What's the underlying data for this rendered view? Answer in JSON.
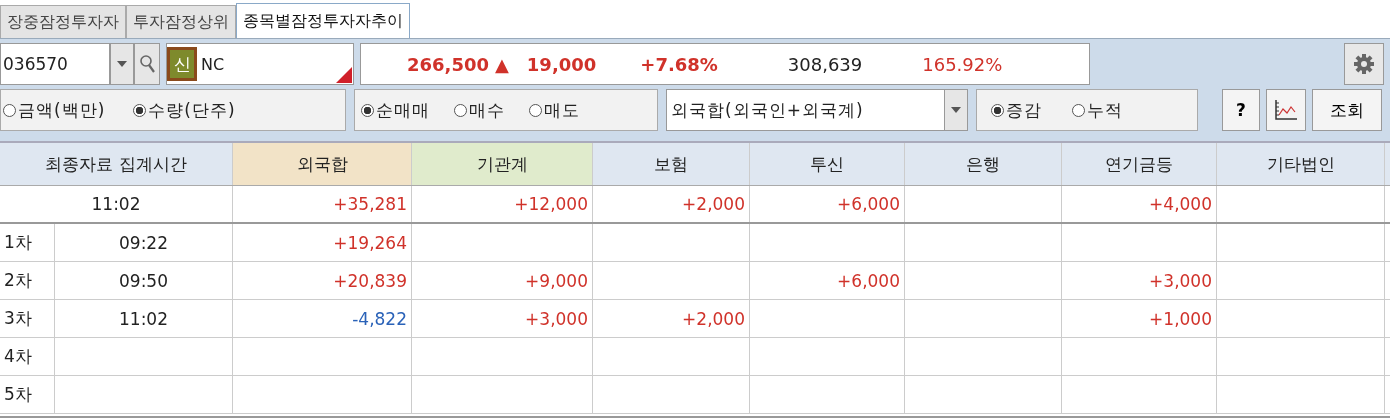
{
  "tabs": [
    {
      "label": "장중잠정투자자",
      "selected": false
    },
    {
      "label": "투자잠정상위",
      "selected": false
    },
    {
      "label": "종목별잠정투자자추이",
      "selected": true
    }
  ],
  "stock": {
    "code": "036570",
    "badge": "신",
    "name": "NC"
  },
  "quote": {
    "price": "266,500",
    "arrow": "▲",
    "change": "19,000",
    "rate": "+7.68%",
    "volume": "308,639",
    "volume_ratio": "165.92%"
  },
  "unit_options": [
    {
      "label": "금액(백만)",
      "selected": false
    },
    {
      "label": "수량(단주)",
      "selected": true
    }
  ],
  "trade_options": [
    {
      "label": "순매매",
      "selected": true
    },
    {
      "label": "매수",
      "selected": false
    },
    {
      "label": "매도",
      "selected": false
    }
  ],
  "investor_select": {
    "value": "외국합(외국인+외국계)"
  },
  "mode_options": [
    {
      "label": "증감",
      "selected": true
    },
    {
      "label": "누적",
      "selected": false
    }
  ],
  "help_button": "?",
  "query_button": "조회",
  "table": {
    "first_header": "최종자료 집계시간",
    "columns": [
      {
        "label": "외국합",
        "color": "#f2e3c7"
      },
      {
        "label": "기관계",
        "color": "#e0ebcc"
      },
      {
        "label": "보험",
        "color": "#dfe7f1"
      },
      {
        "label": "투신",
        "color": "#dfe7f1"
      },
      {
        "label": "은행",
        "color": "#dfe7f1"
      },
      {
        "label": "연기금등",
        "color": "#dfe7f1"
      },
      {
        "label": "기타법인",
        "color": "#dfe7f1"
      }
    ],
    "summary": {
      "time": "11:02",
      "cells": {
        "foreign": {
          "text": "+35,281",
          "color": "#d0322a"
        },
        "institution": {
          "text": "+12,000",
          "color": "#d0322a"
        },
        "insurance": {
          "text": "+2,000",
          "color": "#d0322a"
        },
        "trust": {
          "text": "+6,000",
          "color": "#d0322a"
        },
        "pension": {
          "text": "+4,000",
          "color": "#d0322a"
        }
      }
    },
    "rows": [
      {
        "label": "1차",
        "time": "09:22",
        "cells": {
          "foreign": {
            "text": "+19,264",
            "color": "#d0322a"
          }
        }
      },
      {
        "label": "2차",
        "time": "09:50",
        "cells": {
          "foreign": {
            "text": "+20,839",
            "color": "#d0322a"
          },
          "institution": {
            "text": "+9,000",
            "color": "#d0322a"
          },
          "trust": {
            "text": "+6,000",
            "color": "#d0322a"
          },
          "pension": {
            "text": "+3,000",
            "color": "#d0322a"
          }
        }
      },
      {
        "label": "3차",
        "time": "11:02",
        "cells": {
          "foreign": {
            "text": "-4,822",
            "color": "#2a62b8"
          },
          "institution": {
            "text": "+3,000",
            "color": "#d0322a"
          },
          "insurance": {
            "text": "+2,000",
            "color": "#d0322a"
          },
          "pension": {
            "text": "+1,000",
            "color": "#d0322a"
          }
        }
      },
      {
        "label": "4차"
      },
      {
        "label": "5차"
      }
    ]
  }
}
